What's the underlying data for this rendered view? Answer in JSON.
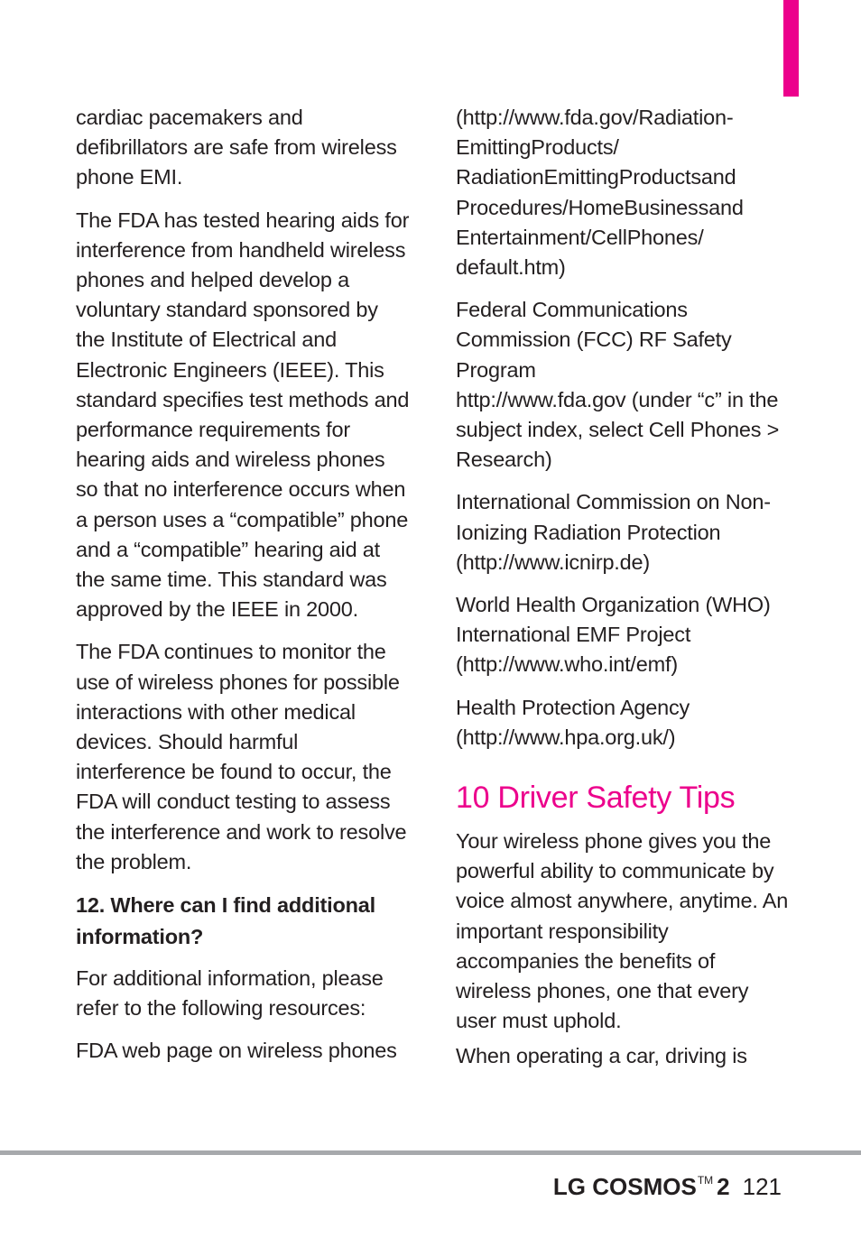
{
  "colors": {
    "accent": "#ec008c",
    "text": "#231f20",
    "rule": "#a7a9ac"
  },
  "left_column": {
    "paragraphs": [
      "cardiac pacemakers and defibrillators are safe from wireless phone EMI.",
      "The FDA has tested hearing aids for interference from handheld wireless phones and helped develop a voluntary standard sponsored by the Institute of Electrical and Electronic Engineers (IEEE). This standard specifies test methods and performance requirements for hearing aids and wireless phones so that no interference occurs when a person uses a “compatible” phone and a “compatible” hearing aid at the same time. This standard was approved by the IEEE in 2000.",
      "The FDA continues to monitor the use of wireless phones for possible interactions with other medical devices. Should harmful interference be found to occur, the FDA will conduct testing to assess the interference and work to resolve the problem."
    ],
    "question_heading": "12. Where can I find additional information?",
    "after_heading": [
      "For additional information, please refer to the following resources:",
      "FDA web page on wireless phones"
    ]
  },
  "right_column": {
    "resources": [
      "(http://www.fda.gov/Radiation-EmittingProducts/ RadiationEmittingProductsand Procedures/HomeBusinessand Entertainment/CellPhones/ default.htm)",
      "Federal Communications Commission (FCC) RF Safety Program",
      "http://www.fda.gov (under “c” in the subject index, select Cell Phones > Research)",
      "International Commission on Non-Ionizing Radiation Protection (http://www.icnirp.de)",
      "World Health Organization (WHO) International EMF Project (http://www.who.int/emf)",
      "Health Protection Agency (http://www.hpa.org.uk/)"
    ],
    "section_title": "10 Driver Safety Tips",
    "section_paragraphs": [
      "Your wireless phone gives you the powerful ability to communicate by voice almost anywhere, anytime. An important responsibility accompanies the benefits of wireless phones, one that every user must uphold.",
      "When operating a car, driving is"
    ]
  },
  "footer": {
    "brand": "LG COSMOS",
    "trademark": "TM",
    "model": "2",
    "page_number": "121"
  }
}
